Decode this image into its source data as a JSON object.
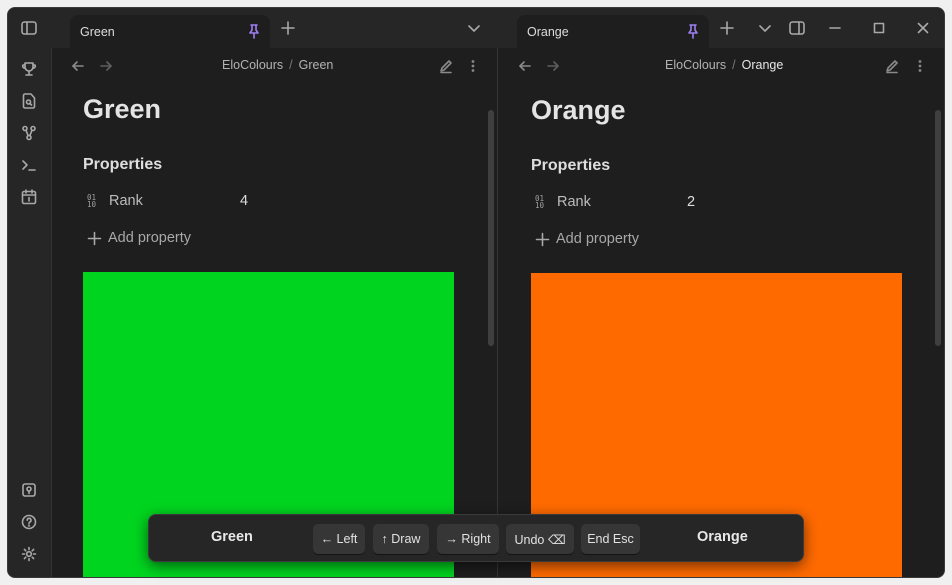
{
  "window": {
    "minimize_icon": "minimize-icon",
    "maximize_icon": "maximize-icon",
    "close_icon": "close-icon"
  },
  "ribbon": {
    "top_icons": [
      "trophy-icon",
      "file-search-icon",
      "graph-icon",
      "terminal-icon",
      "calendar-icon"
    ],
    "bottom_icons": [
      "vault-icon",
      "help-icon",
      "settings-icon"
    ]
  },
  "left_pane": {
    "tab_label": "Green",
    "breadcrumb_folder": "EloColours",
    "breadcrumb_separator": "/",
    "breadcrumb_note": "Green",
    "title": "Green",
    "properties_heading": "Properties",
    "property_key": "Rank",
    "property_value": "4",
    "add_property_label": "Add property",
    "swatch_color": "#00d41f"
  },
  "right_pane": {
    "tab_label": "Orange",
    "breadcrumb_folder": "EloColours",
    "breadcrumb_separator": "/",
    "breadcrumb_note": "Orange",
    "title": "Orange",
    "properties_heading": "Properties",
    "property_key": "Rank",
    "property_value": "2",
    "add_property_label": "Add property",
    "swatch_color": "#ff6a00"
  },
  "number_icon_text": "01\n10",
  "controls": {
    "left_label": "Green",
    "right_label": "Orange",
    "left_button": "← Left",
    "draw_button": "↑ Draw",
    "right_button": "→ Right",
    "undo_button": "Undo ⌫",
    "end_button": "End Esc"
  },
  "colors": {
    "accent": "#9d7ff0",
    "background": "#1e1e1e",
    "chrome": "#262626"
  }
}
